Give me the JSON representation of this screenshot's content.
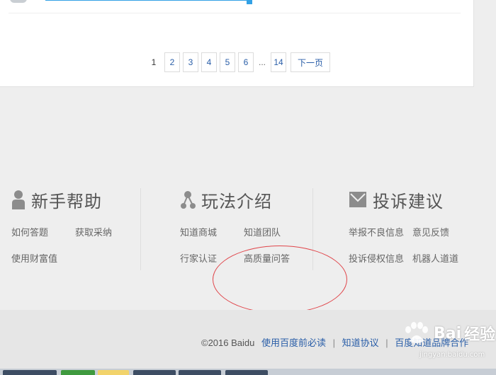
{
  "pagination": {
    "current": "1",
    "pages": [
      "2",
      "3",
      "4",
      "5",
      "6"
    ],
    "ellipsis": "...",
    "last": "14",
    "next_label": "下一页"
  },
  "footer_sections": [
    {
      "title": "新手帮助",
      "icon": "person-icon",
      "links": [
        "如何答题",
        "获取采纳",
        "使用财富值"
      ]
    },
    {
      "title": "玩法介绍",
      "icon": "share-nodes-icon",
      "links": [
        "知道商城",
        "知道团队",
        "行家认证",
        "高质量问答"
      ]
    },
    {
      "title": "投诉建议",
      "icon": "envelope-icon",
      "links": [
        "举报不良信息",
        "意见反馈",
        "投诉侵权信息",
        "机器人道道"
      ]
    }
  ],
  "copyright": {
    "text": "©2016 Baidu",
    "links": [
      "使用百度前必读",
      "知道协议",
      "百度知道品牌合作"
    ],
    "separator": "|"
  },
  "watermark": {
    "brand": "Bai",
    "text": "经验",
    "url": "jingyan.baidu.com"
  },
  "annotation_color": "#e0454a",
  "accent_color": "#2a5ea8"
}
